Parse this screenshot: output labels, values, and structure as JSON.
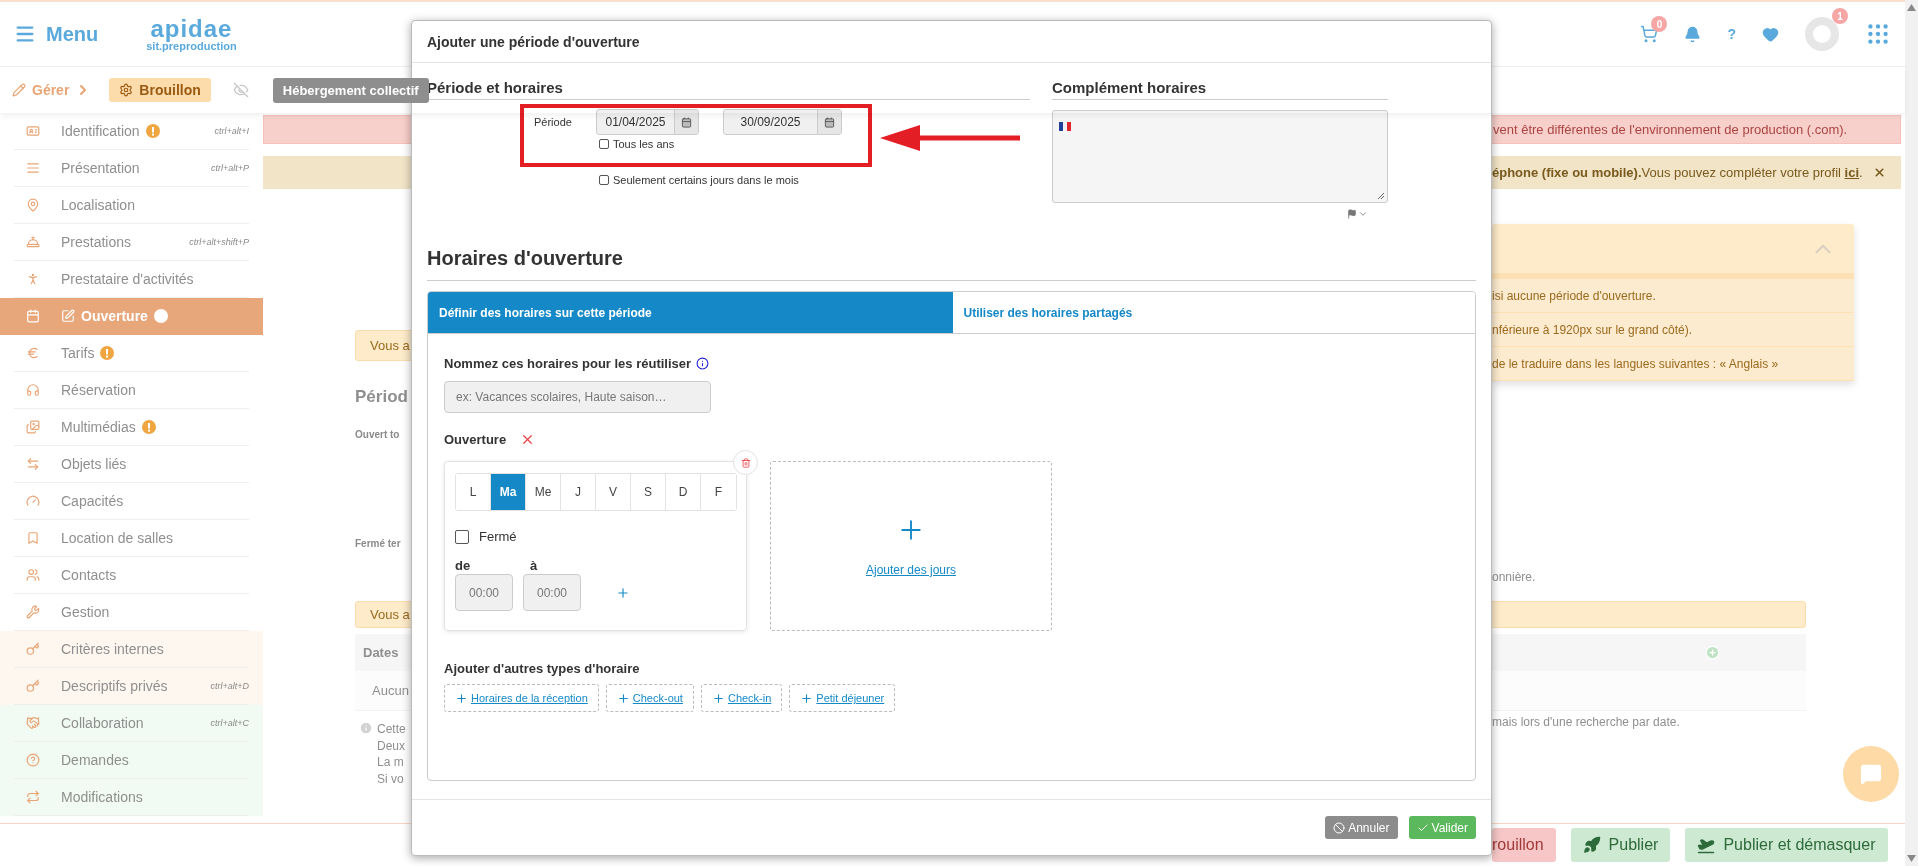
{
  "header": {
    "menu_label": "Menu",
    "logo_title": "apidae",
    "logo_subtitle": "sit.preproduction",
    "cart_count": "0",
    "help_label": "?",
    "notifications_count": "1"
  },
  "toolbar": {
    "manage_label": "Gérer",
    "status_label": "Brouillon",
    "type_label": "Hébergement collectif"
  },
  "sidebar": {
    "items": [
      {
        "label": "Identification",
        "shortcut": "ctrl+alt+I",
        "warning": true,
        "selected": false,
        "kind": "standard"
      },
      {
        "label": "Présentation",
        "shortcut": "ctrl+alt+P",
        "warning": false,
        "selected": false,
        "kind": "standard"
      },
      {
        "label": "Localisation",
        "warning": false,
        "selected": false,
        "kind": "standard"
      },
      {
        "label": "Prestations",
        "shortcut": "ctrl+alt+shift+P",
        "warning": false,
        "selected": false,
        "kind": "standard"
      },
      {
        "label": "Prestataire d'activités",
        "warning": false,
        "selected": false,
        "kind": "standard"
      },
      {
        "label": "Ouverture",
        "warning": true,
        "selected": true,
        "kind": "standard"
      },
      {
        "label": "Tarifs",
        "warning": true,
        "selected": false,
        "kind": "standard"
      },
      {
        "label": "Réservation",
        "warning": false,
        "selected": false,
        "kind": "standard"
      },
      {
        "label": "Multimédias",
        "warning": true,
        "selected": false,
        "kind": "standard"
      },
      {
        "label": "Objets liés",
        "warning": false,
        "selected": false,
        "kind": "standard"
      },
      {
        "label": "Capacités",
        "warning": false,
        "selected": false,
        "kind": "standard"
      },
      {
        "label": "Location de salles",
        "warning": false,
        "selected": false,
        "kind": "standard"
      },
      {
        "label": "Contacts",
        "warning": false,
        "selected": false,
        "kind": "standard"
      },
      {
        "label": "Gestion",
        "warning": false,
        "selected": false,
        "kind": "standard"
      },
      {
        "label": "Critères internes",
        "warning": false,
        "selected": false,
        "kind": "private"
      },
      {
        "label": "Descriptifs privés",
        "shortcut": "ctrl+alt+D",
        "warning": false,
        "selected": false,
        "kind": "private"
      },
      {
        "label": "Collaboration",
        "shortcut": "ctrl+alt+C",
        "warning": false,
        "selected": false,
        "kind": "shared"
      },
      {
        "label": "Demandes",
        "warning": false,
        "selected": false,
        "kind": "shared"
      },
      {
        "label": "Modifications",
        "warning": false,
        "selected": false,
        "kind": "shared"
      }
    ]
  },
  "alerts": {
    "environment": "vent être différentes de l'environnement de production (.com).",
    "profile": {
      "text": "**éphone (fixe ou mobile).**Vous pouvez compléter votre profil ",
      "link": "ici",
      "end": "."
    }
  },
  "completion_panel": {
    "items": [
      "isi aucune période d'ouverture.",
      "nférieure à 1920px sur le grand côté).",
      "de le traduire dans les langues suivantes : « Anglais »"
    ]
  },
  "background_content": {
    "notice_1": "Vous a",
    "heading": "Périod",
    "open_label": "Ouvert to",
    "closed_label": "Fermé ter",
    "note": "onnière.",
    "notice_2": "Vous a",
    "table_header": "Dates",
    "table_empty": "Aucun",
    "info_lines": [
      "Cette",
      "Deux",
      "La m",
      "Si vo"
    ],
    "hint": "mais lors d'une recherche par date."
  },
  "footer": {
    "buttons": [
      {
        "label": "rouillon",
        "kind": "draft"
      },
      {
        "label": "Publier",
        "kind": "publish"
      },
      {
        "label": "Publier et démasquer",
        "kind": "publish_unmask"
      }
    ]
  },
  "modal": {
    "title": "Ajouter une période d'ouverture",
    "period": {
      "heading": "Période et horaires",
      "label": "Période",
      "start": "01/04/2025",
      "end": "30/09/2025",
      "every_year": {
        "label": "Tous les ans",
        "checked": false
      },
      "some_days": {
        "label": "Seulement certains jours dans le mois",
        "checked": false
      }
    },
    "complement": {
      "heading": "Complément horaires"
    },
    "hours": {
      "heading": "Horaires d'ouverture",
      "tabs": [
        {
          "label": "Définir des horaires sur cette période",
          "selected": true
        },
        {
          "label": "Utiliser des horaires partagés",
          "selected": false
        }
      ],
      "name_field": {
        "label": "Nommez ces horaires pour les réutiliser",
        "placeholder": "ex: Vacances scolaires, Haute saison…"
      },
      "opening_label": "Ouverture",
      "days": [
        {
          "label": "L",
          "selected": false
        },
        {
          "label": "Ma",
          "selected": true
        },
        {
          "label": "Me",
          "selected": false
        },
        {
          "label": "J",
          "selected": false
        },
        {
          "label": "V",
          "selected": false
        },
        {
          "label": "S",
          "selected": false
        },
        {
          "label": "D",
          "selected": false
        },
        {
          "label": "F",
          "selected": false
        }
      ],
      "closed": {
        "label": "Fermé",
        "checked": false
      },
      "from": {
        "label": "de",
        "placeholder": "00:00"
      },
      "to": {
        "label": "à",
        "placeholder": "00:00"
      },
      "add_days": "Ajouter des jours",
      "other_types_label": "Ajouter d'autres types d'horaire",
      "other_types": [
        "Horaires de la réception",
        "Check-out",
        "Check-in",
        "Petit déjeuner"
      ]
    },
    "buttons": {
      "cancel": "Annuler",
      "validate": "Valider"
    }
  }
}
